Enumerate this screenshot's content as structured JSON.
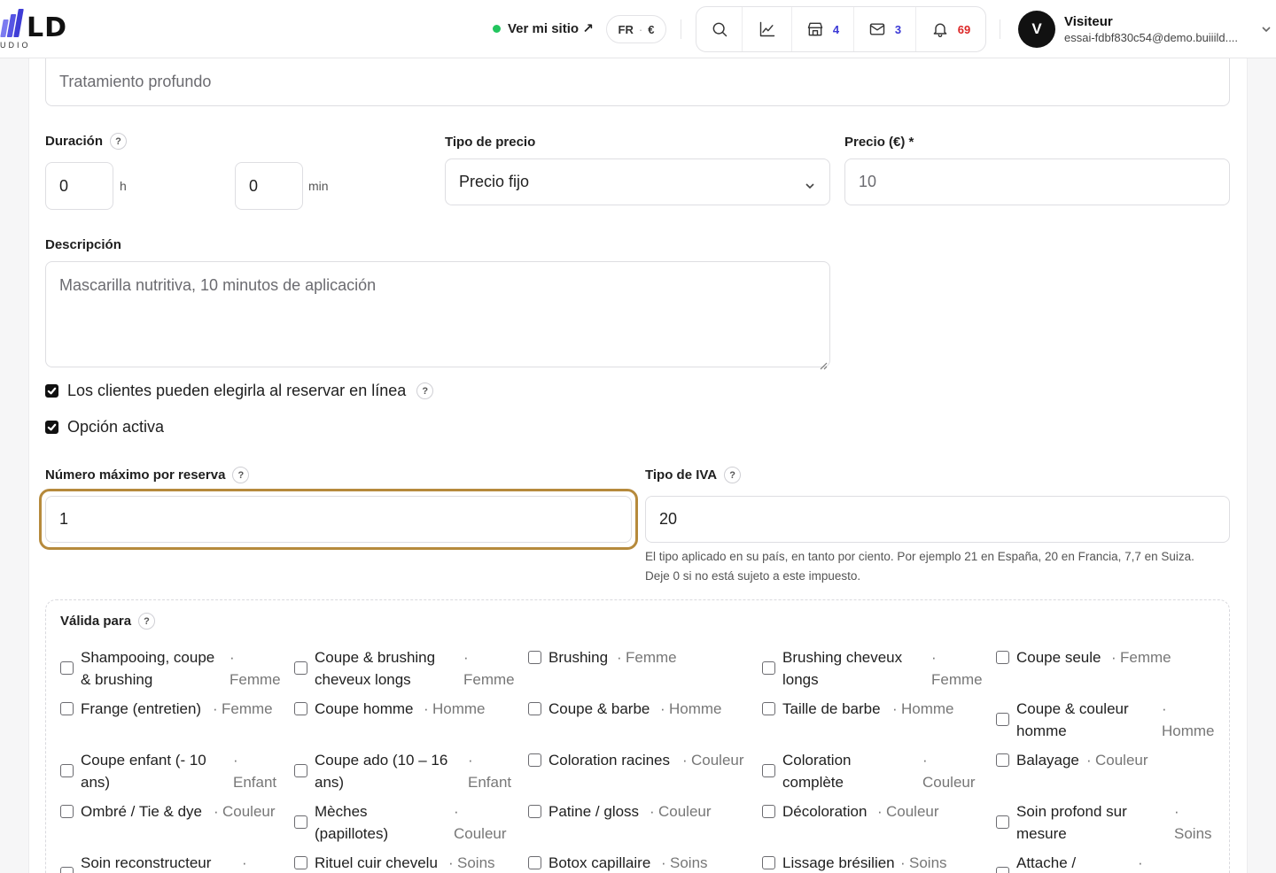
{
  "brand": {
    "logo_text": "LD",
    "logo_sub": "UDIO"
  },
  "header": {
    "site_link": "Ver mi sitio ↗",
    "lang": "FR",
    "currency": "€",
    "tools": [
      {
        "icon": "search-icon"
      },
      {
        "icon": "chart-icon"
      },
      {
        "icon": "store-icon",
        "count": "4"
      },
      {
        "icon": "mail-icon",
        "count": "3"
      },
      {
        "icon": "bell-icon",
        "count": "69"
      }
    ],
    "user": {
      "initial": "V",
      "name": "Visiteur",
      "email": "essai-fdbf830c54@demo.buiiild...."
    }
  },
  "form": {
    "name_value": "Tratamiento profundo",
    "duration": {
      "label": "Duración",
      "hours": "0",
      "hours_unit": "h",
      "minutes": "0",
      "minutes_unit": "min"
    },
    "price_type": {
      "label": "Tipo de precio",
      "value": "Precio fijo"
    },
    "price": {
      "label": "Precio (€) *",
      "value": "10"
    },
    "description": {
      "label": "Descripción",
      "value": "Mascarilla nutritiva, 10 minutos de aplicación"
    },
    "online_booking": {
      "label": "Los clientes pueden elegirla al reservar en línea",
      "checked": true
    },
    "active": {
      "label": "Opción activa",
      "checked": true
    },
    "max_per_booking": {
      "label": "Número máximo por reserva",
      "value": "1"
    },
    "vat": {
      "label": "Tipo de IVA",
      "value": "20",
      "hint": "El tipo aplicado en su país, en tanto por ciento. Por ejemplo 21 en España, 20 en Francia, 7,7 en Suiza. Deje 0 si no está sujeto a este impuesto."
    },
    "valid_for": {
      "label": "Válida para",
      "services": [
        {
          "name": "Shampooing, coupe & brushing",
          "category": "Femme"
        },
        {
          "name": "Coupe & brushing cheveux longs",
          "category": "Femme"
        },
        {
          "name": "Brushing",
          "category": "Femme"
        },
        {
          "name": "Brushing cheveux longs",
          "category": "Femme"
        },
        {
          "name": "Coupe seule",
          "category": "Femme"
        },
        {
          "name": "Frange (entretien)",
          "category": "Femme"
        },
        {
          "name": "Coupe homme",
          "category": "Homme"
        },
        {
          "name": "Coupe & barbe",
          "category": "Homme"
        },
        {
          "name": "Taille de barbe",
          "category": "Homme"
        },
        {
          "name": "Coupe & couleur homme",
          "category": "Homme"
        },
        {
          "name": "Coupe enfant (- 10 ans)",
          "category": "Enfant"
        },
        {
          "name": "Coupe ado (10 – 16 ans)",
          "category": "Enfant"
        },
        {
          "name": "Coloration racines",
          "category": "Couleur"
        },
        {
          "name": "Coloration complète",
          "category": "Couleur"
        },
        {
          "name": "Balayage",
          "category": "Couleur"
        },
        {
          "name": "Ombré / Tie & dye",
          "category": "Couleur"
        },
        {
          "name": "Mèches (papillotes)",
          "category": "Couleur"
        },
        {
          "name": "Patine / gloss",
          "category": "Couleur"
        },
        {
          "name": "Décoloration",
          "category": "Couleur"
        },
        {
          "name": "Soin profond sur mesure",
          "category": "Soins"
        },
        {
          "name": "Soin reconstructeur",
          "category": ""
        },
        {
          "name": "Rituel cuir chevelu",
          "category": "Soins"
        },
        {
          "name": "Botox capillaire",
          "category": "Soins"
        },
        {
          "name": "Lissage brésilien",
          "category": "Soins"
        },
        {
          "name": "Attache /",
          "category": ""
        }
      ]
    }
  },
  "colors": {
    "accent": "#3b39d6",
    "focus_ring": "#b68a3c",
    "online_dot": "#22c55e",
    "notif": "#dc2626"
  }
}
